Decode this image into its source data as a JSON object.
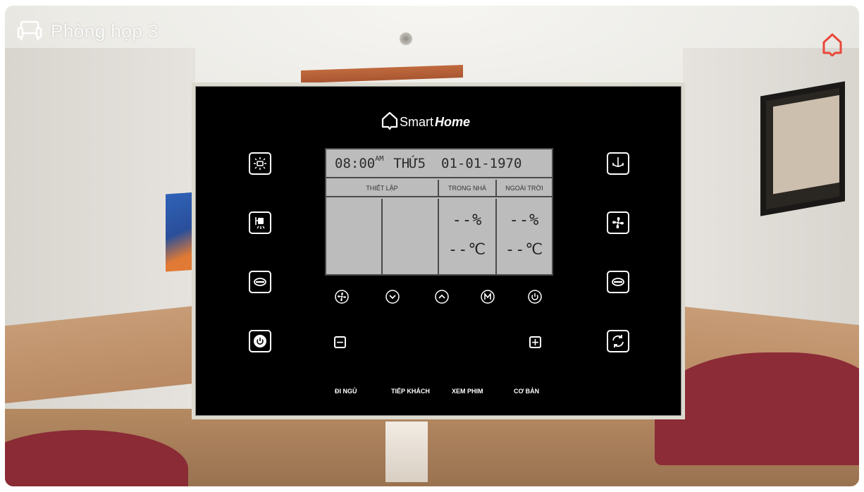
{
  "header": {
    "room_name": "Phòng họp 3"
  },
  "panel": {
    "brand_light": "Smart",
    "brand_bold": "Home",
    "lcd": {
      "time": "08:00",
      "ampm": "AM",
      "day": "THỨ5",
      "date": "01-01-1970",
      "col_setting": "THIẾT LẬP",
      "col_indoor": "TRONG NHÀ",
      "col_outdoor": "NGOÀI TRỜI",
      "indoor_humidity": "--%",
      "indoor_temp": "--℃",
      "outdoor_humidity": "--%",
      "outdoor_temp": "--℃"
    },
    "minus_label": "−",
    "plus_label": "+",
    "scenes": [
      "ĐI NGỦ",
      "TIẾP KHÁCH",
      "XEM PHIM",
      "CƠ BẢN"
    ]
  },
  "colors": {
    "accent_home": "#e8483a",
    "panel_bg": "#000000",
    "lcd_bg": "#bcbcbc"
  }
}
